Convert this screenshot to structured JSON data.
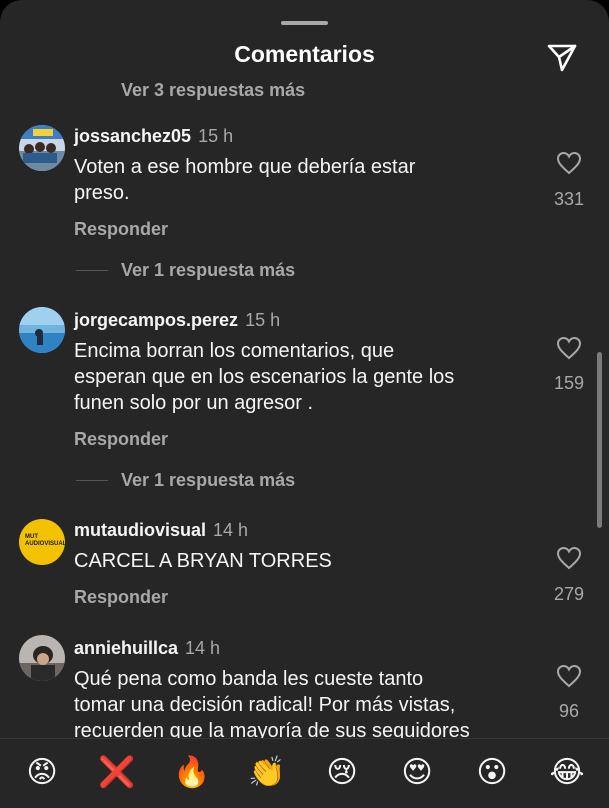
{
  "header": {
    "title": "Comentarios",
    "share_icon": "paper-plane-icon"
  },
  "partial_top": {
    "more_replies": "Ver 3 respuestas más"
  },
  "comments": [
    {
      "username": "jossanchez05",
      "time": "15 h",
      "lines": [
        "Voten a ese hombre que debería estar",
        "preso."
      ],
      "likes": "331",
      "reply": "Responder",
      "more_replies": "Ver 1 respuesta más"
    },
    {
      "username": "jorgecampos.perez",
      "time": "15 h",
      "lines": [
        "Encima borran los comentarios,  que",
        "esperan que en los escenarios la gente los",
        "funen solo por un agresor ."
      ],
      "likes": "159",
      "reply": "Responder",
      "more_replies": "Ver 1 respuesta más"
    },
    {
      "username": "mutaudiovisual",
      "time": "14 h",
      "lines": [
        "CARCEL A BRYAN TORRES"
      ],
      "likes": "279",
      "reply": "Responder",
      "avatar_text": "MUT AUDIOVISUAL"
    },
    {
      "username": "anniehuillca",
      "time": "14 h",
      "lines": [
        "Qué pena como banda les cueste tanto",
        "tomar una decisión radical! Por más vistas,",
        "recuerden que la mayoría de sus seguidores"
      ],
      "likes": "96"
    }
  ],
  "emoji_bar": [
    {
      "name": "angry-face-icon",
      "glyph": "😡"
    },
    {
      "name": "cross-mark-icon",
      "glyph": "❌"
    },
    {
      "name": "fire-icon",
      "glyph": "🔥"
    },
    {
      "name": "clapping-hands-icon",
      "glyph": "👏"
    },
    {
      "name": "crying-face-icon",
      "glyph": "😢"
    },
    {
      "name": "heart-eyes-icon",
      "glyph": "😍"
    },
    {
      "name": "surprised-face-icon",
      "glyph": "😮"
    },
    {
      "name": "tears-of-joy-icon",
      "glyph": "😂"
    }
  ],
  "colors": {
    "sheet_background": "#262626",
    "primary_text": "#f5f5f5",
    "secondary_text": "#a8a8a8"
  }
}
